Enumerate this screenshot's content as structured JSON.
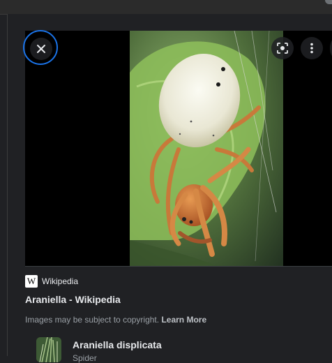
{
  "viewer": {
    "close_icon": "close-icon",
    "lens_icon": "lens-icon",
    "more_icon": "more-vert-icon",
    "accent_color": "#1a73e8",
    "image_subject": "spider"
  },
  "source": {
    "logo_letter": "W",
    "name": "Wikipedia"
  },
  "result": {
    "title": "Araniella - Wikipedia"
  },
  "notice": {
    "text": "Images may be subject to copyright.",
    "link": "Learn More"
  },
  "related": {
    "title": "Araniella displicata",
    "subtitle": "Spider"
  }
}
